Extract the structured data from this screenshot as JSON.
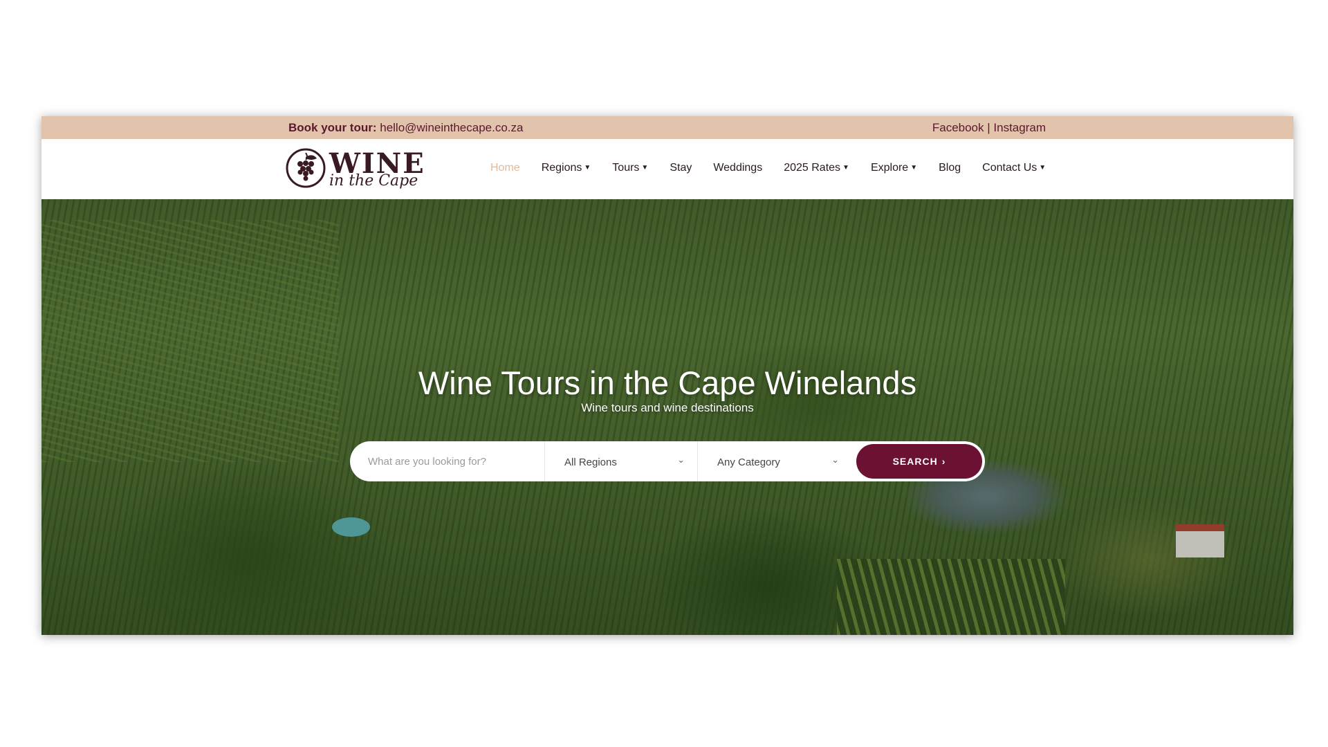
{
  "topbar": {
    "book_label": "Book your tour:",
    "email": "hello@wineinthecape.co.za",
    "facebook": "Facebook",
    "separator": " | ",
    "instagram": "Instagram"
  },
  "logo": {
    "line1": "WINE",
    "line2": "in the Cape"
  },
  "nav": {
    "items": [
      {
        "label": "Home",
        "active": true,
        "dropdown": false
      },
      {
        "label": "Regions",
        "dropdown": true
      },
      {
        "label": "Tours",
        "dropdown": true
      },
      {
        "label": "Stay",
        "dropdown": false
      },
      {
        "label": "Weddings",
        "dropdown": false
      },
      {
        "label": "2025 Rates",
        "dropdown": true
      },
      {
        "label": "Explore",
        "dropdown": true
      },
      {
        "label": "Blog",
        "dropdown": false
      },
      {
        "label": "Contact Us",
        "dropdown": true
      }
    ]
  },
  "hero": {
    "title": "Wine Tours in the Cape Winelands",
    "subtitle": "Wine tours and wine destinations"
  },
  "search": {
    "placeholder": "What are you looking for?",
    "region_value": "All Regions",
    "category_value": "Any Category",
    "button_label": "SEARCH",
    "button_icon": "chevron-right-icon"
  },
  "colors": {
    "topbar_bg": "#e2c3ac",
    "brand": "#6b1133",
    "nav_active": "#e2b99c"
  }
}
